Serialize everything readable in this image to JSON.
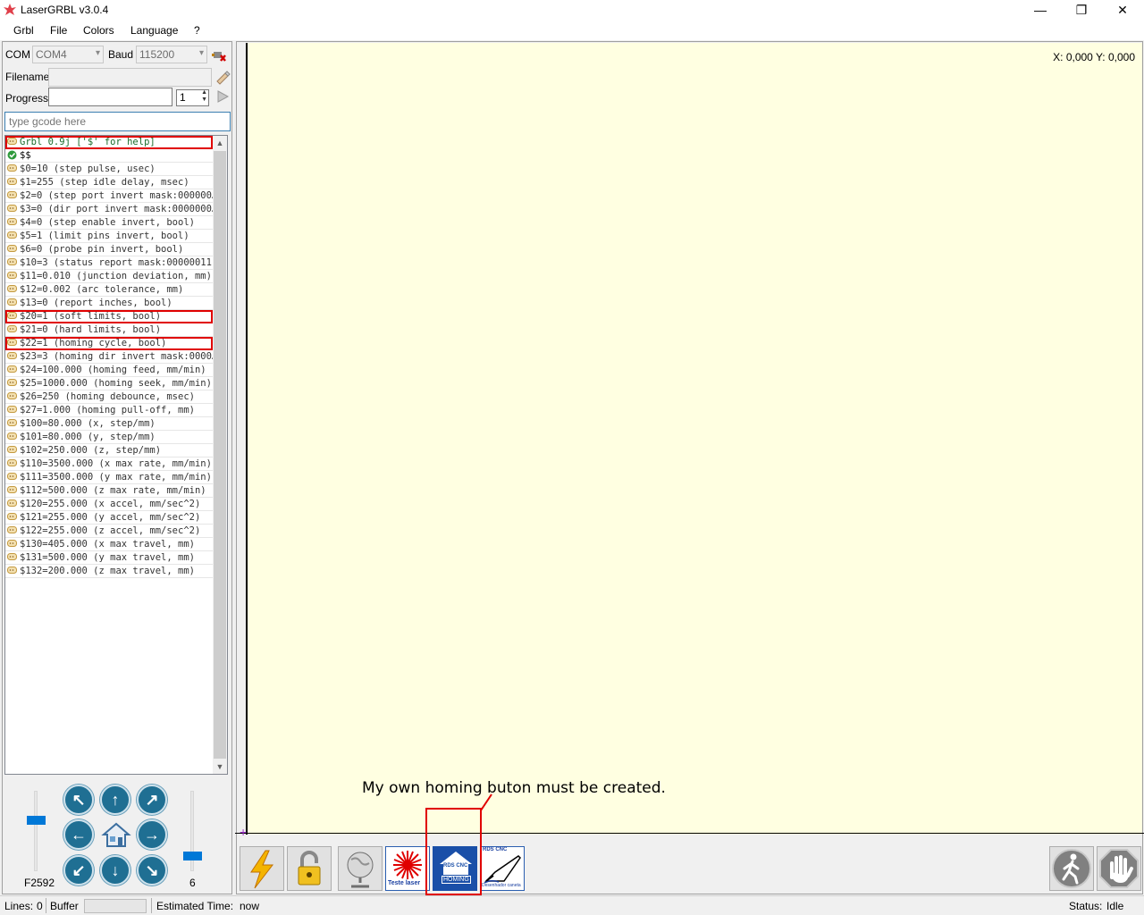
{
  "window": {
    "title": "LaserGRBL v3.0.4",
    "minimize": "—",
    "maximize": "❐",
    "close": "✕"
  },
  "menu": [
    "Grbl",
    "File",
    "Colors",
    "Language",
    "?"
  ],
  "connection": {
    "com_label": "COM",
    "com_value": "COM4",
    "baud_label": "Baud",
    "baud_value": "115200",
    "filename_label": "Filename",
    "filename_value": "",
    "progress_label": "Progress",
    "copies_value": "1"
  },
  "gcode_input": {
    "placeholder": "type gcode here"
  },
  "log": [
    {
      "icon": "info",
      "text": "Grbl 0.9j ['$' for help]",
      "highlight": true
    },
    {
      "icon": "ok",
      "text": "$$",
      "highlight": false
    },
    {
      "icon": "info",
      "text": "$0=10 (step pulse, usec)",
      "highlight": false
    },
    {
      "icon": "info",
      "text": "$1=255 (step idle delay, msec)",
      "highlight": false
    },
    {
      "icon": "info",
      "text": "$2=0 (step port invert mask:000000…",
      "highlight": false
    },
    {
      "icon": "info",
      "text": "$3=0 (dir port invert mask:0000000…",
      "highlight": false
    },
    {
      "icon": "info",
      "text": "$4=0 (step enable invert, bool)",
      "highlight": false
    },
    {
      "icon": "info",
      "text": "$5=1 (limit pins invert, bool)",
      "highlight": false
    },
    {
      "icon": "info",
      "text": "$6=0 (probe pin invert, bool)",
      "highlight": false
    },
    {
      "icon": "info",
      "text": "$10=3 (status report mask:00000011)",
      "highlight": false
    },
    {
      "icon": "info",
      "text": "$11=0.010 (junction deviation, mm)",
      "highlight": false
    },
    {
      "icon": "info",
      "text": "$12=0.002 (arc tolerance, mm)",
      "highlight": false
    },
    {
      "icon": "info",
      "text": "$13=0 (report inches, bool)",
      "highlight": false
    },
    {
      "icon": "info",
      "text": "$20=1 (soft limits, bool)",
      "highlight": true
    },
    {
      "icon": "info",
      "text": "$21=0 (hard limits, bool)",
      "highlight": false
    },
    {
      "icon": "info",
      "text": "$22=1 (homing cycle, bool)",
      "highlight": true
    },
    {
      "icon": "info",
      "text": "$23=3 (homing dir invert mask:0000…",
      "highlight": false
    },
    {
      "icon": "info",
      "text": "$24=100.000 (homing feed, mm/min)",
      "highlight": false
    },
    {
      "icon": "info",
      "text": "$25=1000.000 (homing seek, mm/min)",
      "highlight": false
    },
    {
      "icon": "info",
      "text": "$26=250 (homing debounce, msec)",
      "highlight": false
    },
    {
      "icon": "info",
      "text": "$27=1.000 (homing pull-off, mm)",
      "highlight": false
    },
    {
      "icon": "info",
      "text": "$100=80.000 (x, step/mm)",
      "highlight": false
    },
    {
      "icon": "info",
      "text": "$101=80.000 (y, step/mm)",
      "highlight": false
    },
    {
      "icon": "info",
      "text": "$102=250.000 (z, step/mm)",
      "highlight": false
    },
    {
      "icon": "info",
      "text": "$110=3500.000 (x max rate, mm/min)",
      "highlight": false
    },
    {
      "icon": "info",
      "text": "$111=3500.000 (y max rate, mm/min)",
      "highlight": false
    },
    {
      "icon": "info",
      "text": "$112=500.000 (z max rate, mm/min)",
      "highlight": false
    },
    {
      "icon": "info",
      "text": "$120=255.000 (x accel, mm/sec^2)",
      "highlight": false
    },
    {
      "icon": "info",
      "text": "$121=255.000 (y accel, mm/sec^2)",
      "highlight": false
    },
    {
      "icon": "info",
      "text": "$122=255.000 (z accel, mm/sec^2)",
      "highlight": false
    },
    {
      "icon": "info",
      "text": "$130=405.000 (x max travel, mm)",
      "highlight": false
    },
    {
      "icon": "info",
      "text": "$131=500.000 (y max travel, mm)",
      "highlight": false
    },
    {
      "icon": "info",
      "text": "$132=200.000 (z max travel, mm)",
      "highlight": false
    }
  ],
  "jog": {
    "speed_label": "F2592",
    "step_label": "6",
    "speed_level": 0.65,
    "step_level": 0.15
  },
  "canvas": {
    "coords": "X: 0,000 Y: 0,000",
    "annotation": "My own homing buton must be created."
  },
  "toolbar": {
    "test_laser_label": "Teste laser",
    "homing_brand": "RDS CNC",
    "homing_label": "HOMING",
    "draw_brand": "RDS CNC",
    "draw_label": "Desenhador caneta"
  },
  "status": {
    "lines_label": "Lines:",
    "lines_value": "0",
    "buffer_label": "Buffer",
    "estimated_label": "Estimated Time:",
    "estimated_value": "now",
    "status_label": "Status:",
    "status_value": "Idle"
  },
  "colors": {
    "canvas_bg": "#ffffe1",
    "accent": "#0078d7",
    "highlight": "#e00000"
  }
}
